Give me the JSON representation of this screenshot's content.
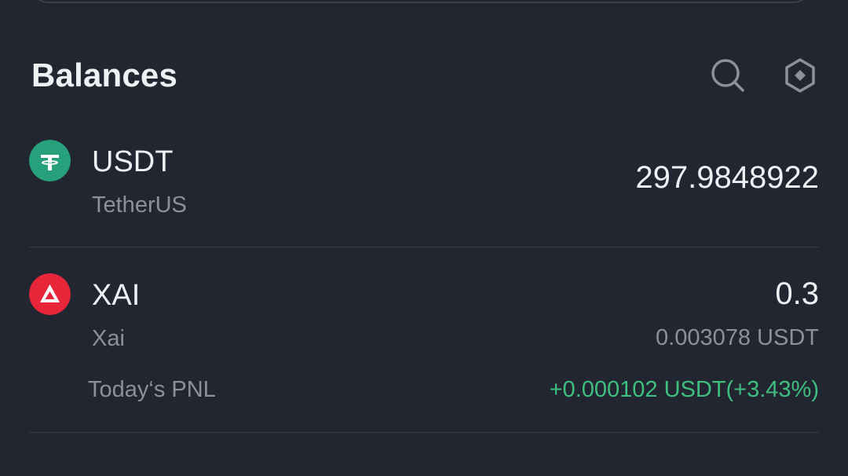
{
  "header": {
    "title": "Balances",
    "icons": [
      "search-icon",
      "settings-hexagon-icon"
    ]
  },
  "balances": [
    {
      "symbol": "USDT",
      "name": "TetherUS",
      "amount": "297.9848922",
      "logo_color": "#26a17b",
      "icon": "tether-logo-icon"
    },
    {
      "symbol": "XAI",
      "name": "Xai",
      "amount": "0.3",
      "value": "0.003078 USDT",
      "pnl_label": "Today‘s PNL",
      "pnl_value": "+0.000102 USDT(+3.43%)",
      "logo_color": "#e8263a",
      "icon": "xai-logo-icon"
    }
  ],
  "colors": {
    "background": "#222631",
    "primary_text": "#eef0f4",
    "secondary_text": "#8c909a",
    "positive": "#3fbf7f",
    "divider": "#363b46"
  }
}
